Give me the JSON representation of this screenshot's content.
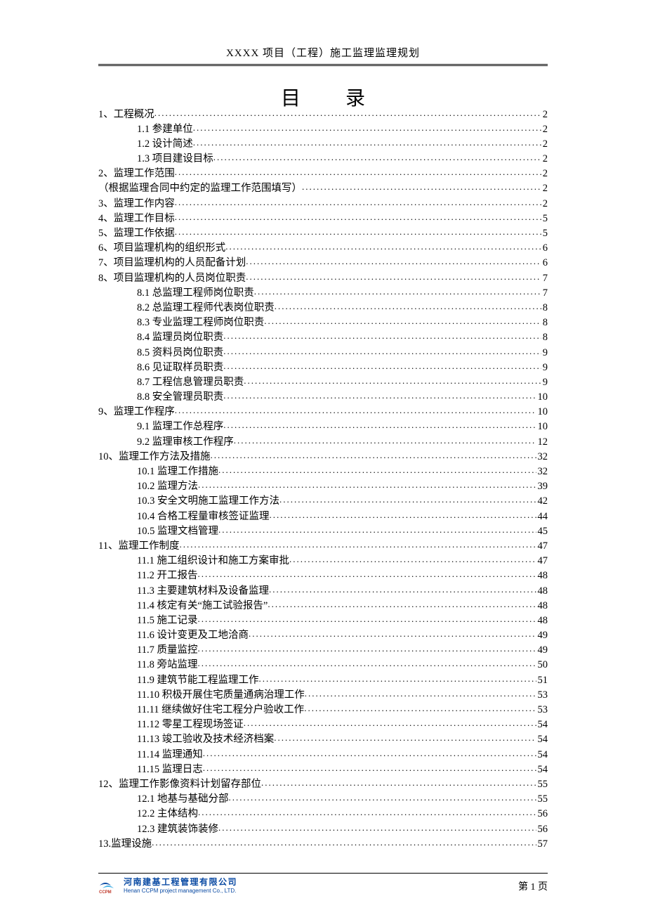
{
  "header": "XXXX 项目（工程）施工监理监理规划",
  "title": "目　录",
  "toc": [
    {
      "level": 1,
      "label": "1、工程概况",
      "page": "2"
    },
    {
      "level": 2,
      "label": "1.1 参建单位",
      "page": "2"
    },
    {
      "level": 2,
      "label": "1.2 设计简述",
      "page": "2"
    },
    {
      "level": 2,
      "label": "1.3 项目建设目标",
      "page": "2"
    },
    {
      "level": 1,
      "label": "2、监理工作范围",
      "page": "2"
    },
    {
      "level": 1,
      "label": "（根据监理合同中约定的监理工作范围填写）",
      "page": "2"
    },
    {
      "level": 1,
      "label": "3、监理工作内容",
      "page": "2"
    },
    {
      "level": 1,
      "label": "4、监理工作目标",
      "page": "5"
    },
    {
      "level": 1,
      "label": "5、监理工作依据",
      "page": "5"
    },
    {
      "level": 1,
      "label": "6、项目监理机构的组织形式",
      "page": "6"
    },
    {
      "level": 1,
      "label": "7、项目监理机构的人员配备计划",
      "page": "6"
    },
    {
      "level": 1,
      "label": "8、项目监理机构的人员岗位职责",
      "page": "7"
    },
    {
      "level": 2,
      "label": "8.1 总监理工程师岗位职责",
      "page": "7"
    },
    {
      "level": 2,
      "label": "8.2 总监理工程师代表岗位职责",
      "page": "8"
    },
    {
      "level": 2,
      "label": "8.3 专业监理工程师岗位职责",
      "page": "8"
    },
    {
      "level": 2,
      "label": "8.4 监理员岗位职责",
      "page": "8"
    },
    {
      "level": 2,
      "label": "8.5 资料员岗位职责",
      "page": "9"
    },
    {
      "level": 2,
      "label": "8.6 见证取样员职责",
      "page": "9"
    },
    {
      "level": 2,
      "label": "8.7 工程信息管理员职责",
      "page": "9"
    },
    {
      "level": 2,
      "label": "8.8 安全管理员职责",
      "page": "10"
    },
    {
      "level": 1,
      "label": "9、监理工作程序",
      "page": "10"
    },
    {
      "level": 2,
      "label": "9.1 监理工作总程序",
      "page": "10"
    },
    {
      "level": 2,
      "label": "9.2 监理审核工作程序",
      "page": "12"
    },
    {
      "level": 1,
      "label": "10、监理工作方法及措施",
      "page": "32"
    },
    {
      "level": 2,
      "label": "10.1 监理工作措施",
      "page": "32"
    },
    {
      "level": 2,
      "label": "10.2 监理方法",
      "page": "39"
    },
    {
      "level": 2,
      "label": "10.3 安全文明施工监理工作方法",
      "page": "42"
    },
    {
      "level": 2,
      "label": "10.4 合格工程量审核签证监理",
      "page": "44"
    },
    {
      "level": 2,
      "label": "10.5 监理文档管理",
      "page": "45"
    },
    {
      "level": 1,
      "label": "11、监理工作制度",
      "page": "47"
    },
    {
      "level": 2,
      "label": "11.1 施工组织设计和施工方案审批",
      "page": "47"
    },
    {
      "level": 2,
      "label": "11.2 开工报告",
      "page": "48"
    },
    {
      "level": 2,
      "label": "11.3 主要建筑材料及设备监理",
      "page": "48"
    },
    {
      "level": 2,
      "label": "11.4 核定有关“施工试验报告”",
      "page": "48"
    },
    {
      "level": 2,
      "label": "11.5 施工记录",
      "page": "48"
    },
    {
      "level": 2,
      "label": "11.6 设计变更及工地洽商",
      "page": "49"
    },
    {
      "level": 2,
      "label": "11.7 质量监控",
      "page": "49"
    },
    {
      "level": 2,
      "label": "11.8 旁站监理",
      "page": "50"
    },
    {
      "level": 2,
      "label": "11.9 建筑节能工程监理工作",
      "page": "51"
    },
    {
      "level": 2,
      "label": "11.10 积极开展住宅质量通病治理工作",
      "page": "53"
    },
    {
      "level": 2,
      "label": "11.11 继续做好住宅工程分户验收工作",
      "page": "53"
    },
    {
      "level": 2,
      "label": "11.12 零星工程现场签证",
      "page": "54"
    },
    {
      "level": 2,
      "label": "11.13 竣工验收及技术经济档案",
      "page": "54"
    },
    {
      "level": 2,
      "label": "11.14 监理通知",
      "page": "54"
    },
    {
      "level": 2,
      "label": "11.15 监理日志",
      "page": "54"
    },
    {
      "level": 1,
      "label": "12、监理工作影像资料计划留存部位",
      "page": "55"
    },
    {
      "level": 2,
      "label": "12.1 地基与基础分部",
      "page": "55"
    },
    {
      "level": 2,
      "label": "12.2 主体结构",
      "page": "56"
    },
    {
      "level": 2,
      "label": "12.3 建筑装饰装修",
      "page": "56"
    },
    {
      "level": 1,
      "label": "13.监理设施",
      "page": "57"
    }
  ],
  "footer": {
    "logo_zh": "河南建基工程管理有限公司",
    "logo_en": "Henan CCPM project management Co., LTD.",
    "page_label": "第 1 页"
  }
}
